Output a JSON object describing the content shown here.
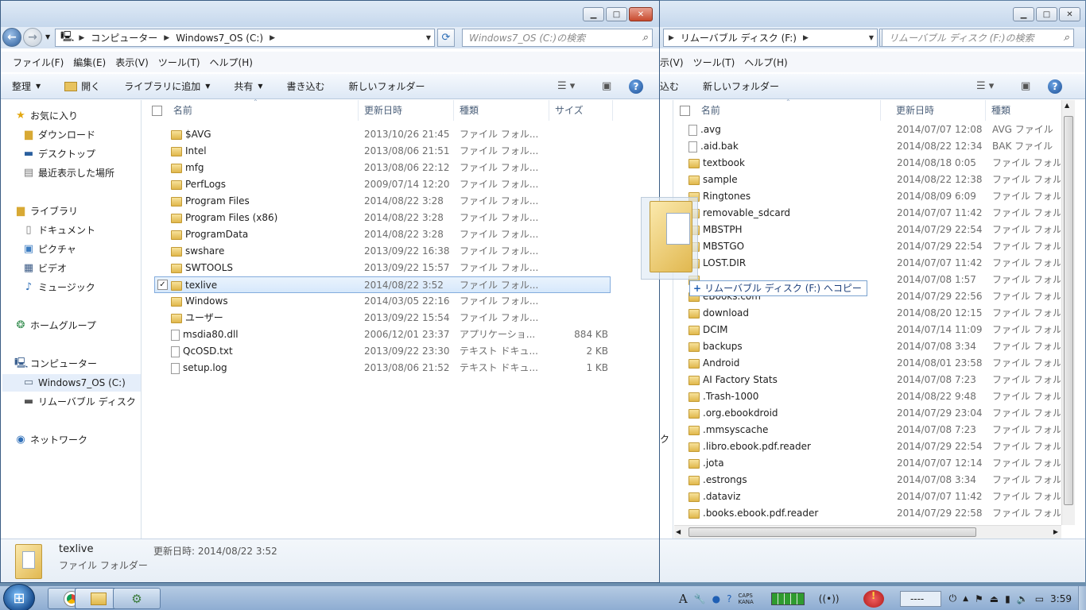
{
  "right_window": {
    "breadcrumb": [
      "リムーバブル ディスク (F:)"
    ],
    "search_placeholder": "リムーバブル ディスク (F:)の検索",
    "menu": [
      "表示(V)",
      "ツール(T)",
      "ヘルプ(H)"
    ],
    "menu_partial_first": "示(V)",
    "commands": [
      "込む",
      "新しいフォルダー"
    ],
    "columns": [
      "名前",
      "更新日時",
      "種類"
    ],
    "files": [
      {
        "name": ".avg",
        "date": "2014/07/07 12:08",
        "type": "AVG ファイル",
        "icon": "file"
      },
      {
        "name": ".aid.bak",
        "date": "2014/08/22 12:34",
        "type": "BAK ファイル",
        "icon": "file"
      },
      {
        "name": "textbook",
        "date": "2014/08/18 0:05",
        "type": "ファイル フォル",
        "icon": "folder"
      },
      {
        "name": "sample",
        "date": "2014/08/22 12:38",
        "type": "ファイル フォル",
        "icon": "folder"
      },
      {
        "name": "Ringtones",
        "date": "2014/08/09 6:09",
        "type": "ファイル フォル",
        "icon": "folder"
      },
      {
        "name": "removable_sdcard",
        "date": "2014/07/07 11:42",
        "type": "ファイル フォル",
        "icon": "folder"
      },
      {
        "name": "MBSTPH",
        "date": "2014/07/29 22:54",
        "type": "ファイル フォル",
        "icon": "folder"
      },
      {
        "name": "MBSTGO",
        "date": "2014/07/29 22:54",
        "type": "ファイル フォル",
        "icon": "folder"
      },
      {
        "name": "LOST.DIR",
        "date": "2014/07/07 11:42",
        "type": "ファイル フォル",
        "icon": "folder"
      },
      {
        "name": "",
        "date": "2014/07/08 1:57",
        "type": "ファイル フォル",
        "icon": "folder"
      },
      {
        "name": "eBooks.com",
        "date": "2014/07/29 22:56",
        "type": "ファイル フォル",
        "icon": "folder"
      },
      {
        "name": "download",
        "date": "2014/08/20 12:15",
        "type": "ファイル フォル",
        "icon": "folder"
      },
      {
        "name": "DCIM",
        "date": "2014/07/14 11:09",
        "type": "ファイル フォル",
        "icon": "folder"
      },
      {
        "name": "backups",
        "date": "2014/07/08 3:34",
        "type": "ファイル フォル",
        "icon": "folder"
      },
      {
        "name": "Android",
        "date": "2014/08/01 23:58",
        "type": "ファイル フォル",
        "icon": "folder"
      },
      {
        "name": "AI Factory Stats",
        "date": "2014/07/08 7:23",
        "type": "ファイル フォル",
        "icon": "folder"
      },
      {
        "name": ".Trash-1000",
        "date": "2014/08/22 9:48",
        "type": "ファイル フォル",
        "icon": "folder"
      },
      {
        "name": ".org.ebookdroid",
        "date": "2014/07/29 23:04",
        "type": "ファイル フォル",
        "icon": "folder"
      },
      {
        "name": ".mmsyscache",
        "date": "2014/07/08 7:23",
        "type": "ファイル フォル",
        "icon": "folder"
      },
      {
        "name": ".libro.ebook.pdf.reader",
        "date": "2014/07/29 22:54",
        "type": "ファイル フォル",
        "icon": "folder"
      },
      {
        "name": ".jota",
        "date": "2014/07/07 12:14",
        "type": "ファイル フォル",
        "icon": "folder"
      },
      {
        "name": ".estrongs",
        "date": "2014/07/08 3:34",
        "type": "ファイル フォル",
        "icon": "folder"
      },
      {
        "name": ".dataviz",
        "date": "2014/07/07 11:42",
        "type": "ファイル フォル",
        "icon": "folder"
      },
      {
        "name": ".books.ebook.pdf.reader",
        "date": "2014/07/29 22:58",
        "type": "ファイル フォル",
        "icon": "folder"
      }
    ],
    "nav_partial": "ク"
  },
  "left_window": {
    "breadcrumb": [
      "コンピューター",
      "Windows7_OS (C:)"
    ],
    "search_placeholder": "Windows7_OS (C:)の検索",
    "menu": [
      "ファイル(F)",
      "編集(E)",
      "表示(V)",
      "ツール(T)",
      "ヘルプ(H)"
    ],
    "commands": {
      "organize": "整理",
      "open": "開く",
      "add_library": "ライブラリに追加",
      "share": "共有",
      "burn": "書き込む",
      "new_folder": "新しいフォルダー"
    },
    "columns": {
      "name": "名前",
      "date": "更新日時",
      "type": "種類",
      "size": "サイズ"
    },
    "nav": {
      "favorites": "お気に入り",
      "downloads": "ダウンロード",
      "desktop": "デスクトップ",
      "recent": "最近表示した場所",
      "libraries": "ライブラリ",
      "documents": "ドキュメント",
      "pictures": "ピクチャ",
      "videos": "ビデオ",
      "music": "ミュージック",
      "homegroup": "ホームグループ",
      "computer": "コンピューター",
      "drive_c": "Windows7_OS (C:)",
      "removable": "リムーバブル ディスク",
      "network": "ネットワーク"
    },
    "files": [
      {
        "name": "$AVG",
        "date": "2013/10/26 21:45",
        "type": "ファイル フォル...",
        "size": "",
        "icon": "folder"
      },
      {
        "name": "Intel",
        "date": "2013/08/06 21:51",
        "type": "ファイル フォル...",
        "size": "",
        "icon": "folder"
      },
      {
        "name": "mfg",
        "date": "2013/08/06 22:12",
        "type": "ファイル フォル...",
        "size": "",
        "icon": "folder"
      },
      {
        "name": "PerfLogs",
        "date": "2009/07/14 12:20",
        "type": "ファイル フォル...",
        "size": "",
        "icon": "folder"
      },
      {
        "name": "Program Files",
        "date": "2014/08/22 3:28",
        "type": "ファイル フォル...",
        "size": "",
        "icon": "folder"
      },
      {
        "name": "Program Files (x86)",
        "date": "2014/08/22 3:28",
        "type": "ファイル フォル...",
        "size": "",
        "icon": "folder"
      },
      {
        "name": "ProgramData",
        "date": "2014/08/22 3:28",
        "type": "ファイル フォル...",
        "size": "",
        "icon": "folder"
      },
      {
        "name": "swshare",
        "date": "2013/09/22 16:38",
        "type": "ファイル フォル...",
        "size": "",
        "icon": "folder"
      },
      {
        "name": "SWTOOLS",
        "date": "2013/09/22 15:57",
        "type": "ファイル フォル...",
        "size": "",
        "icon": "folder"
      },
      {
        "name": "texlive",
        "date": "2014/08/22 3:52",
        "type": "ファイル フォル...",
        "size": "",
        "icon": "folder",
        "selected": true
      },
      {
        "name": "Windows",
        "date": "2014/03/05 22:16",
        "type": "ファイル フォル...",
        "size": "",
        "icon": "folder"
      },
      {
        "name": "ユーザー",
        "date": "2013/09/22 15:54",
        "type": "ファイル フォル...",
        "size": "",
        "icon": "folder"
      },
      {
        "name": "msdia80.dll",
        "date": "2006/12/01 23:37",
        "type": "アプリケーショ...",
        "size": "884 KB",
        "icon": "file"
      },
      {
        "name": "QcOSD.txt",
        "date": "2013/09/22 23:30",
        "type": "テキスト ドキュ...",
        "size": "2 KB",
        "icon": "file"
      },
      {
        "name": "setup.log",
        "date": "2013/08/06 21:52",
        "type": "テキスト ドキュ...",
        "size": "1 KB",
        "icon": "file"
      }
    ],
    "details": {
      "name": "texlive",
      "date_label": "更新日時: 2014/08/22 3:52",
      "type": "ファイル フォルダー"
    }
  },
  "drag": {
    "tooltip": "リムーバブル ディスク (F:) へコピー"
  },
  "taskbar": {
    "clock": "3:59",
    "ime": "A",
    "caps": "CAPS",
    "kana": "KANA",
    "battery_text": "----"
  }
}
